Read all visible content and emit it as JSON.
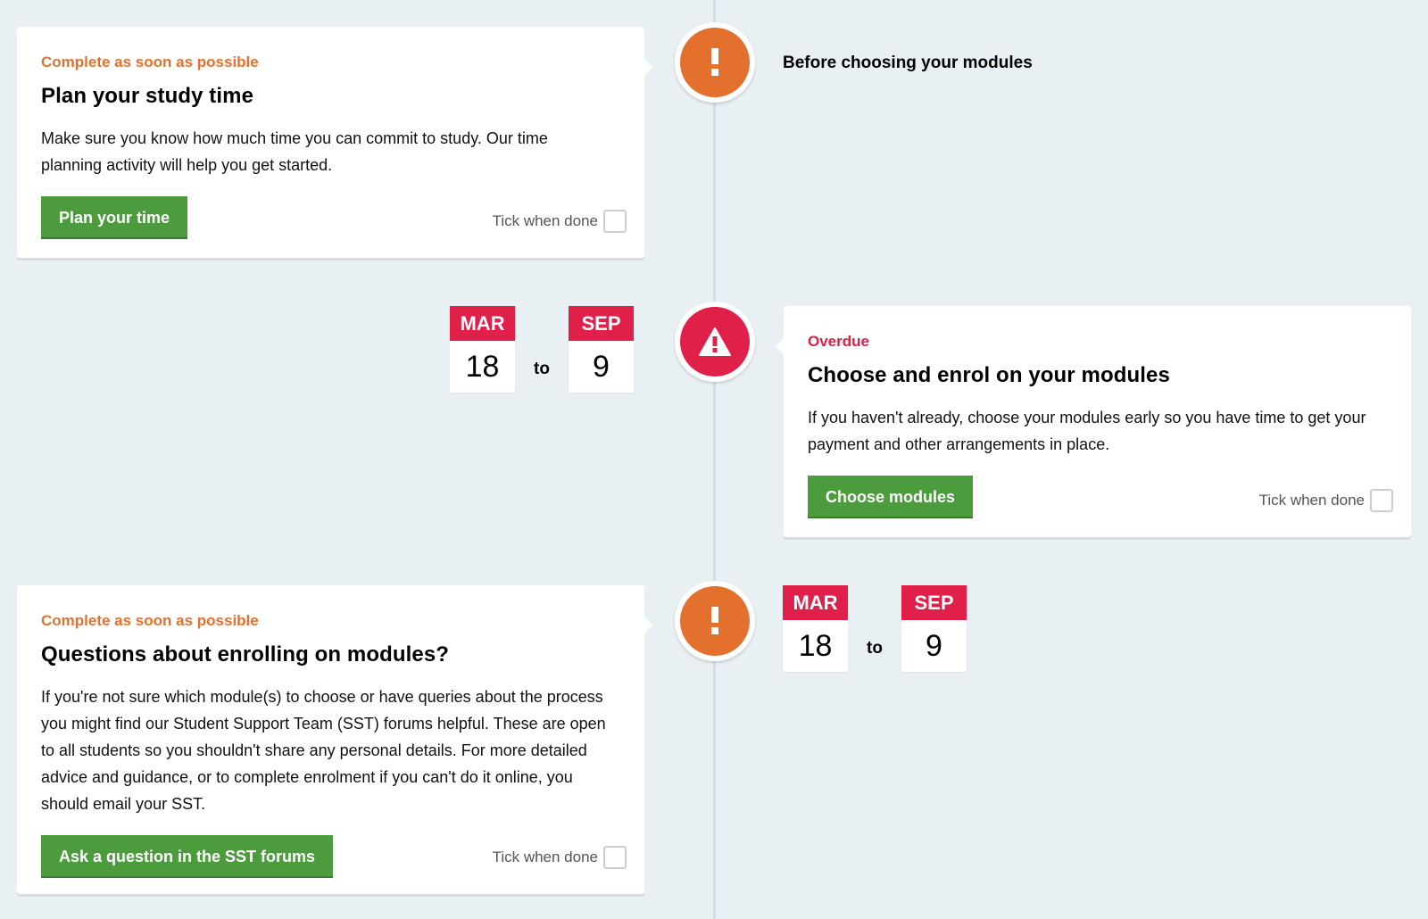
{
  "section_heading": "Before choosing your modules",
  "items": [
    {
      "status": "Complete as soon as possible",
      "title": "Plan your study time",
      "body": "Make sure you know how much time you can commit to study. Our time planning activity will help you get started.",
      "button": "Plan your time",
      "tick": "Tick when done"
    },
    {
      "status": "Overdue",
      "title": "Choose and enrol on your modules",
      "body": "If you haven't already, choose your modules early so you have time to get your payment and other arrangements in place.",
      "button": "Choose modules",
      "tick": "Tick when done",
      "date_from": {
        "month": "MAR",
        "day": "18"
      },
      "date_to": {
        "month": "SEP",
        "day": "9"
      },
      "to_label": "to"
    },
    {
      "status": "Complete as soon as possible",
      "title": "Questions about enrolling on modules?",
      "body": "If you're not sure which module(s) to choose or have queries about the process you might find our Student Support Team (SST) forums helpful. These are open to all students so you shouldn't share any personal details. For more detailed advice and guidance, or to complete enrolment if you can't do it online, you should email your SST.",
      "button": "Ask a question in the SST forums",
      "tick": "Tick when done",
      "date_from": {
        "month": "MAR",
        "day": "18"
      },
      "date_to": {
        "month": "SEP",
        "day": "9"
      },
      "to_label": "to"
    }
  ],
  "icons": [
    "exclamation-icon",
    "warning-triangle-icon",
    "exclamation-icon"
  ],
  "colors": {
    "background": "#e9f0f4",
    "accent_orange": "#e3712d",
    "accent_red": "#e02049",
    "button_green": "#4c9c3e"
  }
}
